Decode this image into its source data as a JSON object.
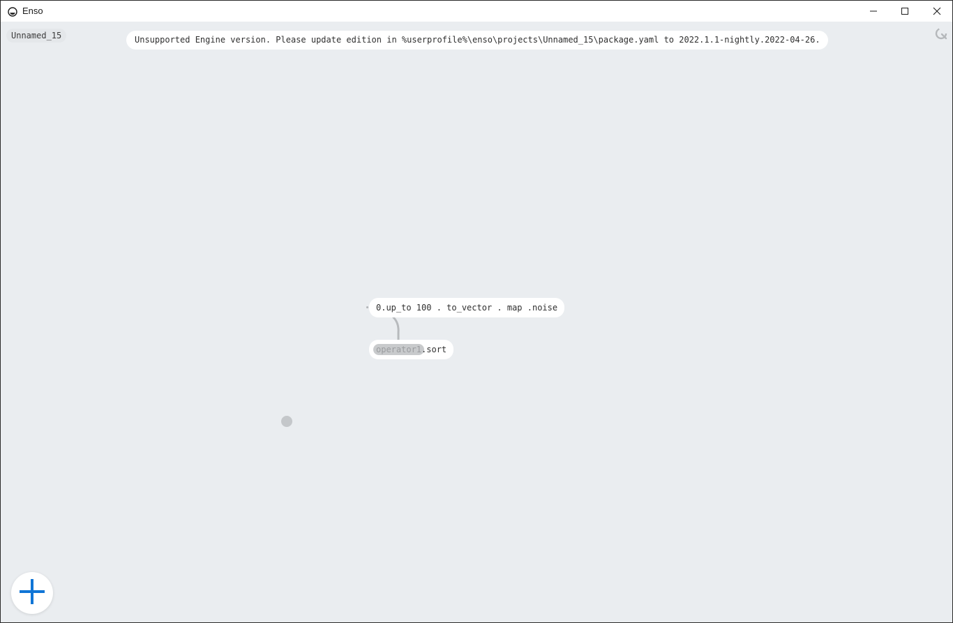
{
  "window": {
    "title": "Enso",
    "icon": "enso-logo-icon",
    "controls": {
      "minimize": "minimize-icon",
      "maximize": "maximize-icon",
      "close": "close-icon"
    }
  },
  "project": {
    "name": "Unnamed_15"
  },
  "notification": {
    "text": "Unsupported Engine version. Please update edition in %userprofile%\\enso\\projects\\Unnamed_15\\package.yaml to 2022.1.1-nightly.2022-04-26."
  },
  "graph": {
    "nodes": [
      {
        "expression": "0.up_to 100 . to_vector . map .noise"
      },
      {
        "operand": "operator1",
        "method": ".sort"
      }
    ]
  },
  "toolbar": {
    "add_node_icon": "plus-icon"
  },
  "colors": {
    "canvas_bg": "#eaedf0",
    "node_bg": "#ffffff",
    "accent": "#1075d6",
    "edge": "#b7babd"
  }
}
